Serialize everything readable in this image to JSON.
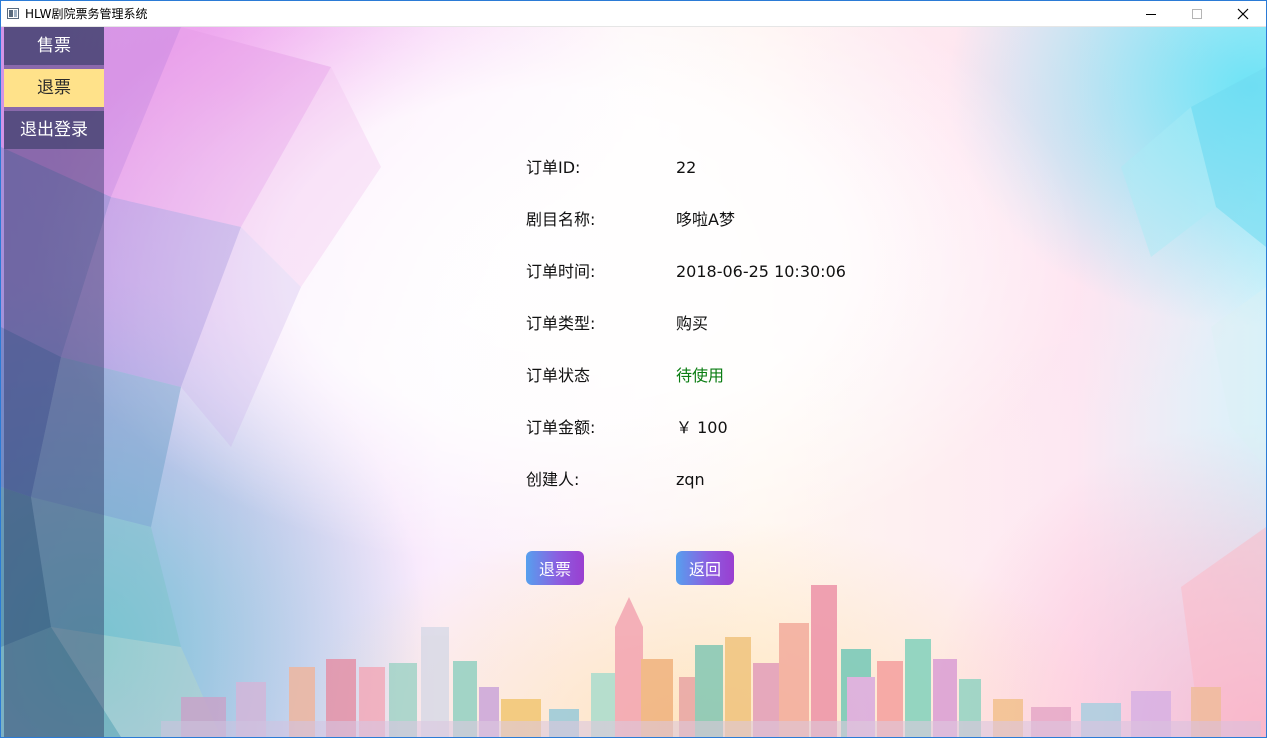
{
  "window": {
    "title": "HLW剧院票务管理系统"
  },
  "sidebar": {
    "items": [
      {
        "label": "售票",
        "active": false
      },
      {
        "label": "退票",
        "active": true
      },
      {
        "label": "退出登录",
        "active": false
      }
    ]
  },
  "order": {
    "id_label": "订单ID:",
    "id_value": "22",
    "play_label": "剧目名称:",
    "play_value": "哆啦A梦",
    "time_label": "订单时间:",
    "time_value": "2018-06-25 10:30:06",
    "type_label": "订单类型:",
    "type_value": "购买",
    "status_label": "订单状态",
    "status_value": "待使用",
    "amount_label": "订单金额:",
    "amount_value": "￥ 100",
    "creator_label": "创建人:",
    "creator_value": "zqn"
  },
  "actions": {
    "refund_label": "退票",
    "back_label": "返回"
  },
  "colors": {
    "active_tab": "#ffe28a",
    "status_ok": "#0a7d12",
    "button_gradient_start": "#56a0ee",
    "button_gradient_end": "#9a3ed0"
  }
}
